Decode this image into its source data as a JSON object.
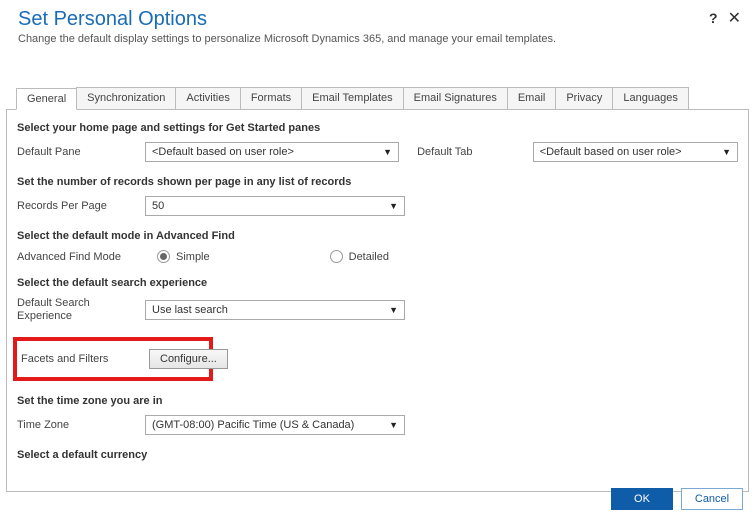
{
  "header": {
    "title": "Set Personal Options",
    "subtitle": "Change the default display settings to personalize Microsoft Dynamics 365, and manage your email templates."
  },
  "tabs": [
    {
      "label": "General",
      "active": true
    },
    {
      "label": "Synchronization"
    },
    {
      "label": "Activities"
    },
    {
      "label": "Formats"
    },
    {
      "label": "Email Templates"
    },
    {
      "label": "Email Signatures"
    },
    {
      "label": "Email"
    },
    {
      "label": "Privacy"
    },
    {
      "label": "Languages"
    }
  ],
  "sections": {
    "homepage": {
      "heading": "Select your home page and settings for Get Started panes",
      "default_pane_label": "Default Pane",
      "default_pane_value": "<Default based on user role>",
      "default_tab_label": "Default Tab",
      "default_tab_value": "<Default based on user role>"
    },
    "records": {
      "heading": "Set the number of records shown per page in any list of records",
      "rpp_label": "Records Per Page",
      "rpp_value": "50"
    },
    "advfind": {
      "heading": "Select the default mode in Advanced Find",
      "mode_label": "Advanced Find Mode",
      "opt_simple": "Simple",
      "opt_detailed": "Detailed"
    },
    "search": {
      "heading": "Select the default search experience",
      "exp_label": "Default Search Experience",
      "exp_value": "Use last search",
      "facets_label": "Facets and Filters",
      "configure_btn": "Configure..."
    },
    "tz": {
      "heading": "Set the time zone you are in",
      "tz_label": "Time Zone",
      "tz_value": "(GMT-08:00) Pacific Time (US & Canada)"
    },
    "currency": {
      "heading": "Select a default currency"
    }
  },
  "footer": {
    "ok": "OK",
    "cancel": "Cancel"
  }
}
